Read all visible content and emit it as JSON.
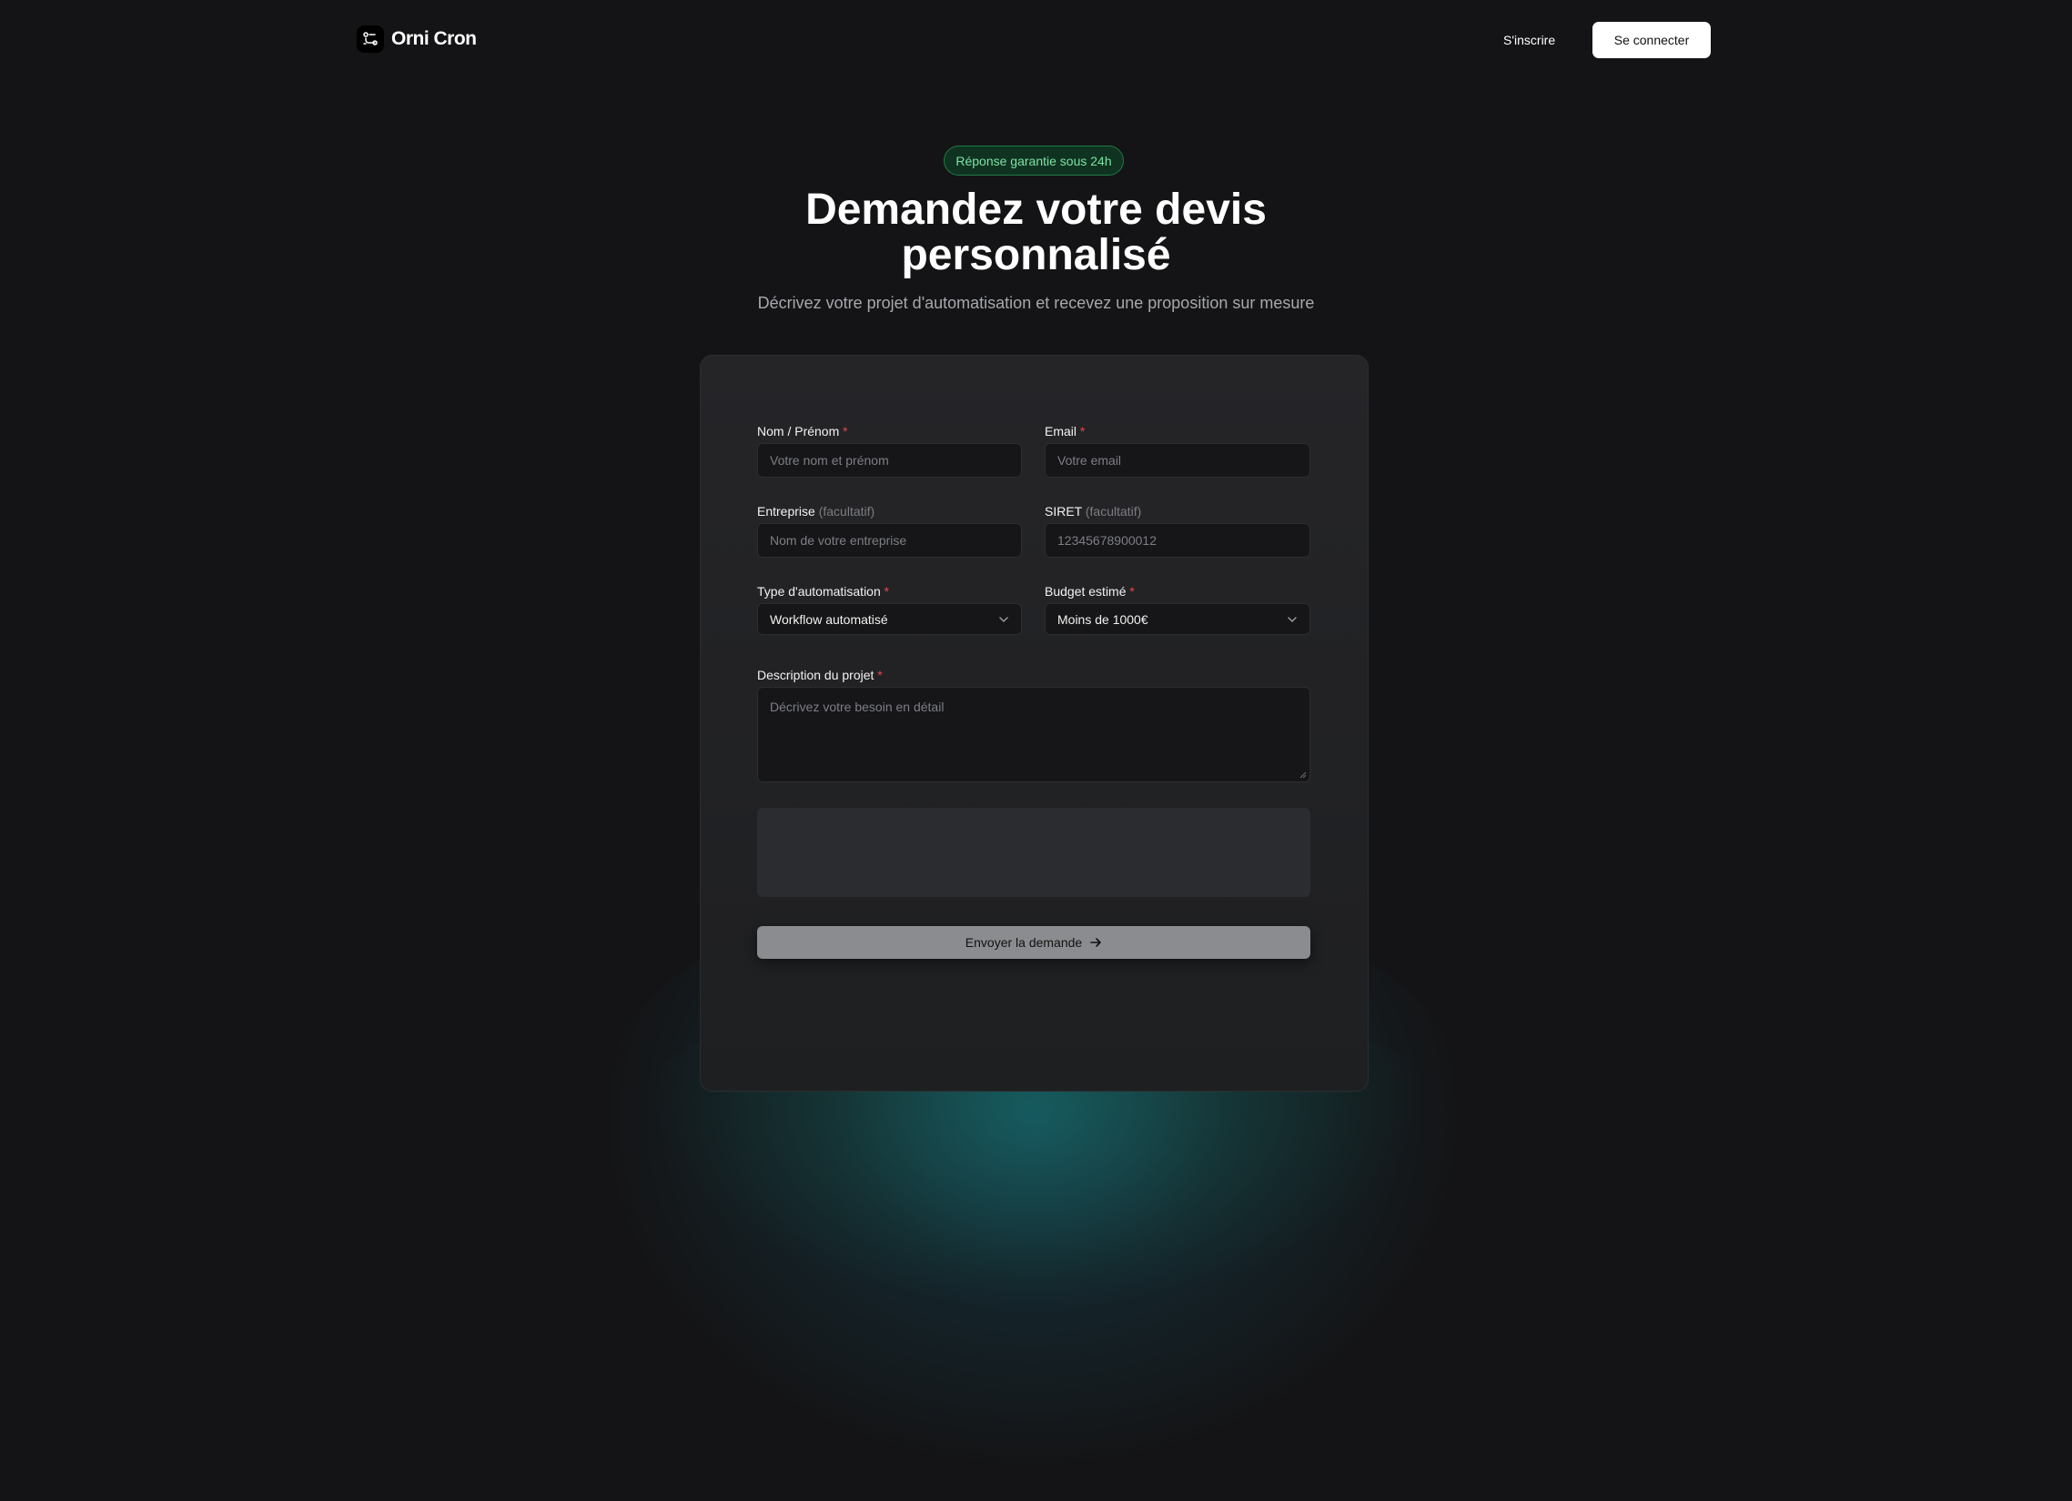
{
  "header": {
    "brand": "Orni Cron",
    "signup_label": "S'inscrire",
    "login_label": "Se connecter"
  },
  "hero": {
    "badge": "Réponse garantie sous 24h",
    "title_line1": "Demandez votre devis",
    "title_line2": "personnalisé",
    "subtitle": "Décrivez votre projet d'automatisation et recevez une proposition sur mesure"
  },
  "form": {
    "name": {
      "label": "Nom / Prénom",
      "required": "*",
      "placeholder": "Votre nom et prénom"
    },
    "email": {
      "label": "Email",
      "required": "*",
      "placeholder": "Votre email"
    },
    "company": {
      "label": "Entreprise",
      "optional": "(facultatif)",
      "placeholder": "Nom de votre entreprise"
    },
    "siret": {
      "label": "SIRET",
      "optional": "(facultatif)",
      "placeholder": "12345678900012"
    },
    "automation_type": {
      "label": "Type d'automatisation",
      "required": "*",
      "value": "Workflow automatisé"
    },
    "budget": {
      "label": "Budget estimé",
      "required": "*",
      "value": "Moins de 1000€"
    },
    "description": {
      "label": "Description du projet",
      "required": "*",
      "placeholder": "Décrivez votre besoin en détail"
    },
    "submit_label": "Envoyer la demande"
  },
  "colors": {
    "background": "#141416",
    "card": "#232326",
    "badge_border": "#1f7a45",
    "badge_text": "#7ee2a5",
    "required": "#e5484d",
    "submit": "#8b8c8f"
  },
  "icons": {
    "logo": "workflow-icon",
    "select": "chevron-down-icon",
    "submit": "arrow-right-icon"
  }
}
